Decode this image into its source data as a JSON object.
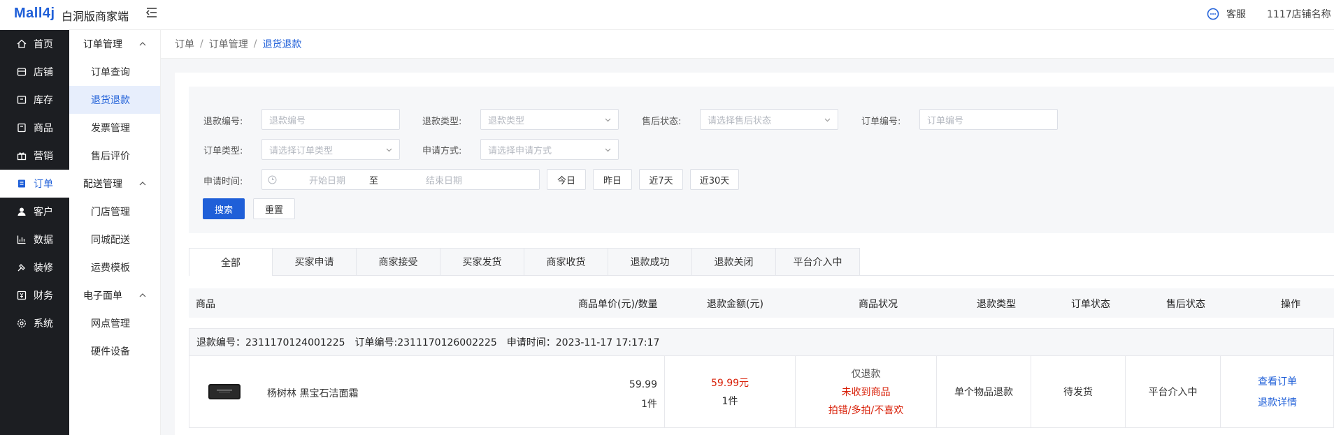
{
  "header": {
    "logo": "Mall4j",
    "brand": "白洞版商家端",
    "service_label": "客服",
    "shop_name": "1117店铺名称"
  },
  "nav_main": [
    {
      "label": "首页",
      "icon": "home-icon"
    },
    {
      "label": "店铺",
      "icon": "store-icon"
    },
    {
      "label": "库存",
      "icon": "inventory-icon"
    },
    {
      "label": "商品",
      "icon": "product-icon"
    },
    {
      "label": "营销",
      "icon": "gift-icon"
    },
    {
      "label": "订单",
      "icon": "order-icon",
      "active": true
    },
    {
      "label": "客户",
      "icon": "user-icon"
    },
    {
      "label": "数据",
      "icon": "chart-icon"
    },
    {
      "label": "装修",
      "icon": "paint-icon"
    },
    {
      "label": "财务",
      "icon": "finance-icon"
    },
    {
      "label": "系统",
      "icon": "gear-icon"
    }
  ],
  "nav_sub": {
    "group1": "订单管理",
    "order_query": "订单查询",
    "return_refund": "退货退款",
    "invoice": "发票管理",
    "review": "售后评价",
    "group2": "配送管理",
    "store_mgmt": "门店管理",
    "same_city": "同城配送",
    "freight": "运费模板",
    "group3": "电子面单",
    "outlet": "网点管理",
    "hardware": "硬件设备"
  },
  "breadcrumb": {
    "l1": "订单",
    "l2": "订单管理",
    "l3": "退货退款",
    "sep": "/"
  },
  "filter": {
    "refund_no_label": "退款编号:",
    "refund_no_placeholder": "退款编号",
    "refund_type_label": "退款类型:",
    "refund_type_placeholder": "退款类型",
    "after_status_label": "售后状态:",
    "after_status_placeholder": "请选择售后状态",
    "order_no_label": "订单编号:",
    "order_no_placeholder": "订单编号",
    "order_type_label": "订单类型:",
    "order_type_placeholder": "请选择订单类型",
    "apply_way_label": "申请方式:",
    "apply_way_placeholder": "请选择申请方式",
    "apply_time_label": "申请时间:",
    "start_date": "开始日期",
    "to": "至",
    "end_date": "结束日期",
    "today": "今日",
    "yesterday": "昨日",
    "last7": "近7天",
    "last30": "近30天",
    "search": "搜索",
    "reset": "重置"
  },
  "tabs": [
    "全部",
    "买家申请",
    "商家接受",
    "买家发货",
    "商家收货",
    "退款成功",
    "退款关闭",
    "平台介入中"
  ],
  "table_head": {
    "product": "商品",
    "unit_price": "商品单价(元)/数量",
    "refund_amount": "退款金额(元)",
    "product_status": "商品状况",
    "refund_type": "退款类型",
    "order_status": "订单状态",
    "after_status": "售后状态",
    "action": "操作"
  },
  "order": {
    "refund_no": "退款编号：2311170124001225",
    "order_no": "订单编号:2311170126002225",
    "apply_time": "申请时间：2023-11-17 17:17:17",
    "product_name": "杨树林 黑宝石洁面霜",
    "price": "59.99",
    "qty": "1件",
    "refund_amount": "59.99元",
    "refund_qty": "1件",
    "cond_type": "仅退款",
    "cond_reason": "未收到商品",
    "cond_detail": "拍错/多拍/不喜欢",
    "refund_type": "单个物品退款",
    "order_status": "待发货",
    "after_status": "平台介入中",
    "view_order": "查看订单",
    "refund_detail": "退款详情"
  }
}
